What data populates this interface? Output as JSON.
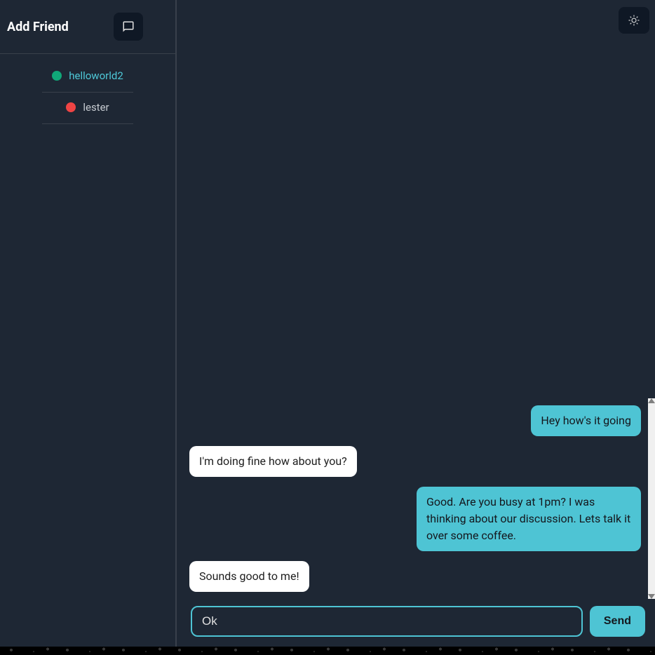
{
  "sidebar": {
    "title": "Add Friend",
    "friends": [
      {
        "name": "helloworld2",
        "status": "online",
        "active": true
      },
      {
        "name": "lester",
        "status": "offline",
        "active": false
      }
    ]
  },
  "messages": [
    {
      "text": "Hey how's it going",
      "type": "sent"
    },
    {
      "text": "I'm doing fine how about you?",
      "type": "received"
    },
    {
      "text": "Good. Are you busy at 1pm? I was thinking about our discussion. Lets talk it over some coffee.",
      "type": "sent"
    },
    {
      "text": "Sounds good to me!",
      "type": "received"
    }
  ],
  "input": {
    "value": "Ok",
    "send_label": "Send"
  }
}
